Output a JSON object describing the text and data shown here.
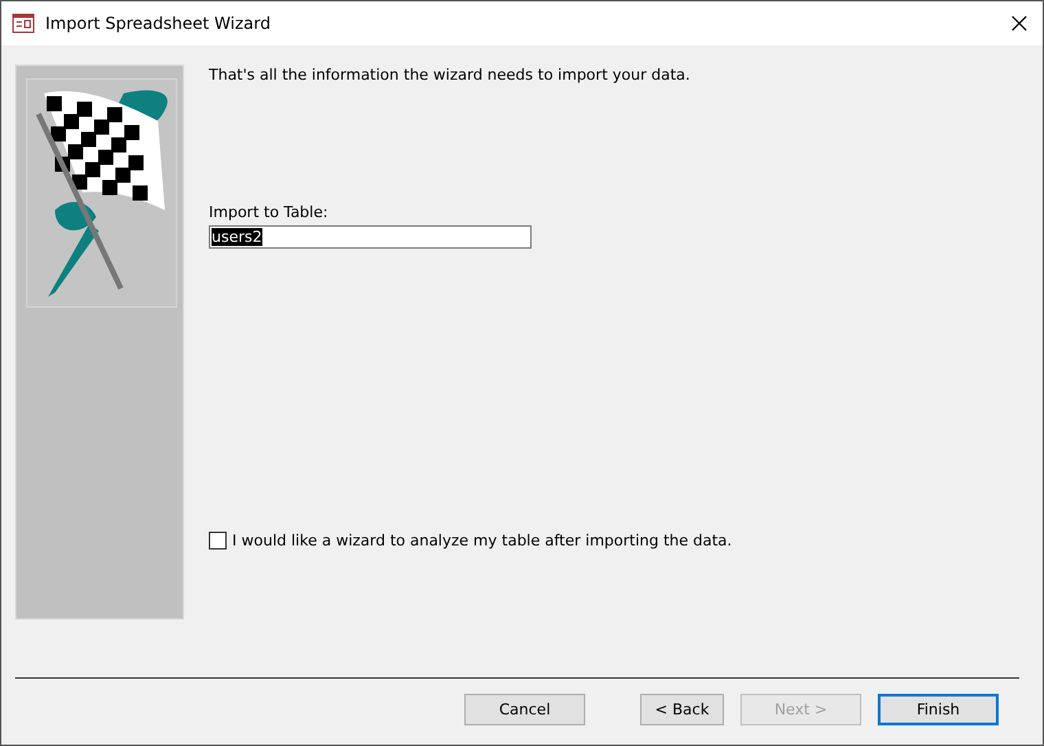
{
  "window": {
    "title": "Import Spreadsheet Wizard"
  },
  "message": "That's all the information the wizard needs to import your data.",
  "table_field": {
    "label": "Import to Table:",
    "value": "users2",
    "text_selected": true
  },
  "analyze_checkbox": {
    "label": "I would like a wizard to analyze my table after importing the data.",
    "checked": false
  },
  "buttons": [
    {
      "label": "Cancel",
      "disabled": false,
      "default": false
    },
    {
      "label": "< Back",
      "disabled": false,
      "default": false
    },
    {
      "label": "Next >",
      "disabled": true,
      "default": false
    },
    {
      "label": "Finish",
      "disabled": false,
      "default": true
    }
  ]
}
